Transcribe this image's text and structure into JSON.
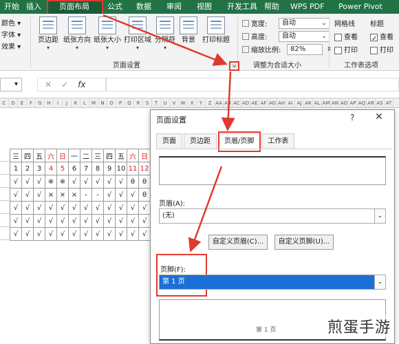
{
  "ribbon_tabs": [
    "开始",
    "插入",
    "页面布局",
    "公式",
    "数据",
    "审阅",
    "视图",
    "开发工具",
    "帮助",
    "WPS PDF",
    "Power Pivot"
  ],
  "active_tab_index": 2,
  "ribbon_left": [
    "颜色 ▾",
    "字体 ▾",
    "效果 ▾"
  ],
  "page_setup_buttons": [
    {
      "label": "页边距"
    },
    {
      "label": "纸张方向"
    },
    {
      "label": "纸张大小"
    },
    {
      "label": "打印区域"
    },
    {
      "label": "分隔符"
    },
    {
      "label": "背景"
    },
    {
      "label": "打印标题"
    }
  ],
  "page_setup_group_label": "页面设置",
  "scale": {
    "width_label": "宽度:",
    "width_value": "自动",
    "height_label": "高度:",
    "height_value": "自动",
    "ratio_label": "缩放比例:",
    "ratio_value": "82%",
    "group_label": "调整为合适大小"
  },
  "sheet_options": {
    "gridlines_title": "网格线",
    "headings_title": "标题",
    "view_label": "查看",
    "print_label": "打印",
    "gridlines_view": false,
    "gridlines_print": false,
    "headings_view": true,
    "headings_print": false,
    "group_label": "工作表选项"
  },
  "formula_bar": {
    "fx": "fx"
  },
  "column_headers": [
    "C",
    "D",
    "E",
    "F",
    "G",
    "H",
    "I",
    "J",
    "K",
    "L",
    "M",
    "N",
    "O",
    "P",
    "Q",
    "R",
    "S",
    "T",
    "U",
    "V",
    "W",
    "X",
    "Y",
    "Z",
    "AA",
    "AB",
    "AC",
    "AD",
    "AE",
    "AF",
    "AG",
    "AH",
    "AI",
    "AJ",
    "AK",
    "AL",
    "AM",
    "AN",
    "AO",
    "AP",
    "AQ",
    "AR",
    "AS",
    "AT"
  ],
  "grid_rows": [
    [
      "三",
      "四",
      "五",
      "六",
      "日",
      "一",
      "二",
      "三",
      "四",
      "五",
      "六",
      "日"
    ],
    [
      "1",
      "2",
      "3",
      "4",
      "5",
      "6",
      "7",
      "8",
      "9",
      "10",
      "11",
      "12"
    ],
    [
      "√",
      "√",
      "√",
      "※",
      "※",
      "√",
      "√",
      "√",
      "√",
      "√",
      "θ",
      "θ"
    ],
    [
      "√",
      "√",
      "√",
      "×",
      "×",
      "×",
      "-",
      "-",
      "√",
      "√",
      "√",
      "θ"
    ],
    [
      "√",
      "√",
      "√",
      "√",
      "√",
      "√",
      "√",
      "√",
      "√",
      "√",
      "√",
      "√"
    ],
    [
      "√",
      "√",
      "√",
      "√",
      "√",
      "√",
      "√",
      "√",
      "√",
      "√",
      "√",
      "√"
    ],
    [
      "√",
      "√",
      "√",
      "√",
      "√",
      "√",
      "√",
      "√",
      "√",
      "√",
      "√",
      "√"
    ]
  ],
  "dialog": {
    "title": "页面设置",
    "help": "?",
    "close": "✕",
    "tabs": [
      "页面",
      "页边距",
      "页眉/页脚",
      "工作表"
    ],
    "active_tab_index": 2,
    "header_label": "页眉(A):",
    "header_value": "(无)",
    "custom_header_button": "自定义页眉(C)...",
    "custom_footer_button": "自定义页脚(U)...",
    "footer_label": "页脚(F):",
    "footer_value": "第 1 页",
    "footer_preview_text": "第 1 页"
  },
  "watermark": "煎蛋手游",
  "colors": {
    "ribbon_green": "#217346",
    "highlight_red": "#e03a2e",
    "selection_blue": "#1c6fd6"
  }
}
